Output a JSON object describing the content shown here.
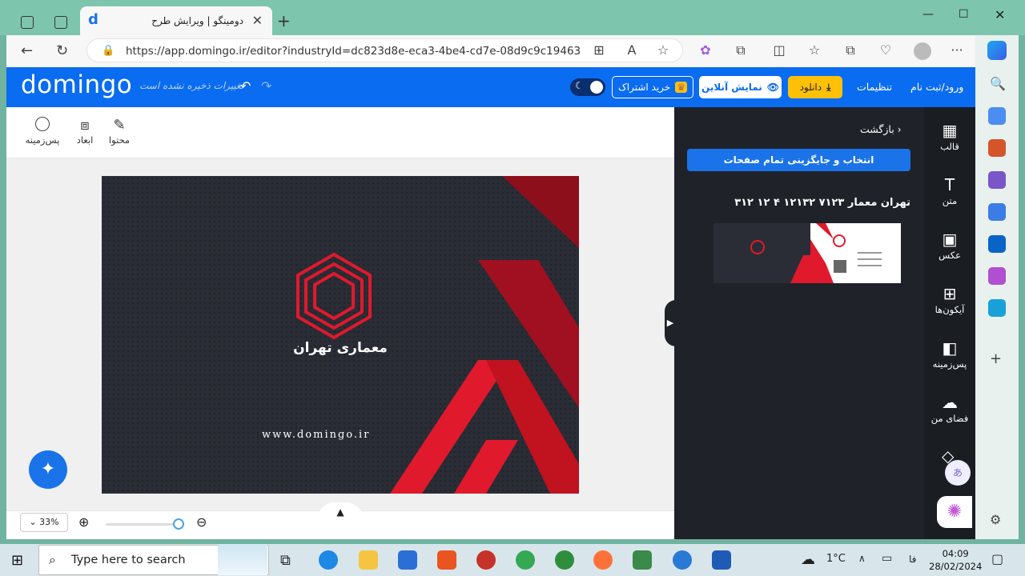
{
  "browser": {
    "tab_title": "دومینگو | ویرایش طرح",
    "url": "https://app.domingo.ir/editor?industryId=dc823d8e-eca3-4be4-cd7e-08d9c9c19463"
  },
  "header": {
    "logo": "domingo",
    "unsaved_note": "تغییرات ذخیره نشده است",
    "share_label": "خرید اشتراک",
    "preview_label": "نمایش آنلاین",
    "download_label": "دانلود",
    "settings_label": "تنظیمات",
    "login_label": "ورود/ثبت نام"
  },
  "subtoolbar": {
    "items": [
      {
        "label": "پس‌زمینه",
        "icon": "background-icon"
      },
      {
        "label": "ابعاد",
        "icon": "dimensions-icon"
      },
      {
        "label": "محتوا",
        "icon": "edit-icon"
      }
    ]
  },
  "canvas": {
    "brand_name": "معماری تهران",
    "website": "www.domingo.ir"
  },
  "zoom": {
    "level": "33%"
  },
  "panel": {
    "back_label": "بازگشت",
    "select_all_label": "انتخاب و جایگزینی تمام صفحات",
    "template_title": "تهران معمار ۷۱۲۳ ۱۲۱۳۲ ۴ ۱۲ ۳۱۲"
  },
  "sidenav": {
    "items": [
      {
        "label": "قالب",
        "icon": "template-icon"
      },
      {
        "label": "متن",
        "icon": "text-icon"
      },
      {
        "label": "عکس",
        "icon": "image-icon"
      },
      {
        "label": "آیکون‌ها",
        "icon": "icons-grid-icon"
      },
      {
        "label": "پس‌زمینه",
        "icon": "background-icon"
      },
      {
        "label": "فضای من",
        "icon": "cloud-upload-icon"
      }
    ]
  },
  "taskbar": {
    "search_placeholder": "Type here to search",
    "temperature": "1°C",
    "language": "فا",
    "time": "04:09",
    "date": "28/02/2024"
  },
  "colors": {
    "brand_blue": "#0a6cf0",
    "accent_red": "#e0192d",
    "dark_panel": "#1f2229",
    "download_yellow": "#ffc107"
  }
}
